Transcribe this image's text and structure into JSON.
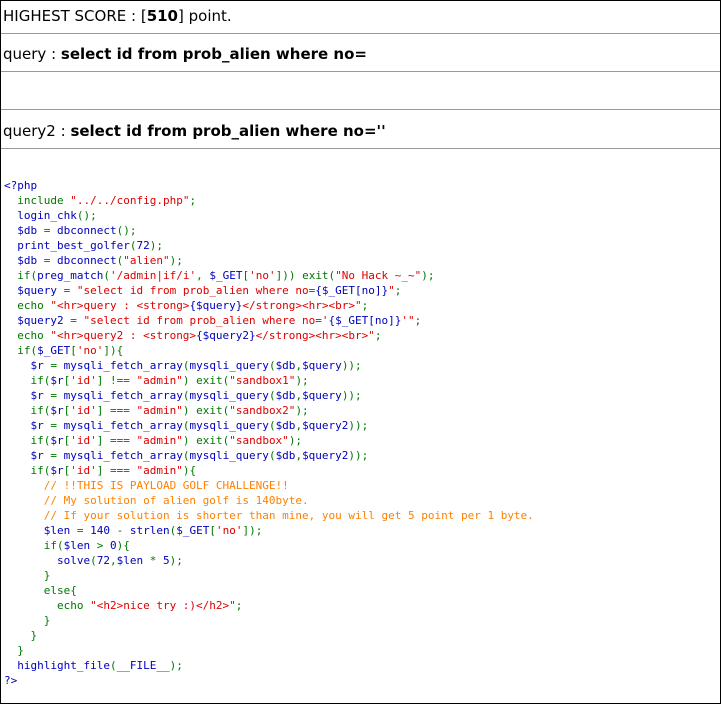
{
  "score": {
    "prefix": "HIGHEST SCORE : [",
    "value": "510",
    "suffix": "] point."
  },
  "query1": {
    "label": "query : ",
    "value": "select id from prob_alien where no="
  },
  "query2": {
    "label": "query2 : ",
    "value": "select id from prob_alien where no=''"
  },
  "source_code": [
    [
      {
        "t": "<?php",
        "c": "d"
      }
    ],
    [
      {
        "t": "  include ",
        "c": "k"
      },
      {
        "t": "\"../../config.php\"",
        "c": "s"
      },
      {
        "t": ";",
        "c": "k"
      }
    ],
    [
      {
        "t": "  login_chk",
        "c": "d"
      },
      {
        "t": "();",
        "c": "k"
      }
    ],
    [
      {
        "t": "  $db ",
        "c": "d"
      },
      {
        "t": "= ",
        "c": "k"
      },
      {
        "t": "dbconnect",
        "c": "d"
      },
      {
        "t": "();",
        "c": "k"
      }
    ],
    [
      {
        "t": "  print_best_golfer",
        "c": "d"
      },
      {
        "t": "(",
        "c": "k"
      },
      {
        "t": "72",
        "c": "d"
      },
      {
        "t": ");",
        "c": "k"
      }
    ],
    [
      {
        "t": "  $db ",
        "c": "d"
      },
      {
        "t": "= ",
        "c": "k"
      },
      {
        "t": "dbconnect",
        "c": "d"
      },
      {
        "t": "(",
        "c": "k"
      },
      {
        "t": "\"alien\"",
        "c": "s"
      },
      {
        "t": ");",
        "c": "k"
      }
    ],
    [
      {
        "t": "  if(",
        "c": "k"
      },
      {
        "t": "preg_match",
        "c": "d"
      },
      {
        "t": "(",
        "c": "k"
      },
      {
        "t": "'/admin|if/i'",
        "c": "s"
      },
      {
        "t": ", ",
        "c": "k"
      },
      {
        "t": "$_GET",
        "c": "d"
      },
      {
        "t": "[",
        "c": "k"
      },
      {
        "t": "'no'",
        "c": "s"
      },
      {
        "t": "])) exit(",
        "c": "k"
      },
      {
        "t": "\"No Hack ~_~\"",
        "c": "s"
      },
      {
        "t": ");",
        "c": "k"
      }
    ],
    [
      {
        "t": "  $query ",
        "c": "d"
      },
      {
        "t": "= ",
        "c": "k"
      },
      {
        "t": "\"select id from prob_alien where no=",
        "c": "s"
      },
      {
        "t": "{$_GET[no]}",
        "c": "d"
      },
      {
        "t": "\"",
        "c": "s"
      },
      {
        "t": ";",
        "c": "k"
      }
    ],
    [
      {
        "t": "  echo ",
        "c": "k"
      },
      {
        "t": "\"<hr>query : <strong>",
        "c": "s"
      },
      {
        "t": "{$query}",
        "c": "d"
      },
      {
        "t": "</strong><hr><br>\"",
        "c": "s"
      },
      {
        "t": ";",
        "c": "k"
      }
    ],
    [
      {
        "t": "  $query2 ",
        "c": "d"
      },
      {
        "t": "= ",
        "c": "k"
      },
      {
        "t": "\"select id from prob_alien where no='",
        "c": "s"
      },
      {
        "t": "{$_GET[no]}",
        "c": "d"
      },
      {
        "t": "'\"",
        "c": "s"
      },
      {
        "t": ";",
        "c": "k"
      }
    ],
    [
      {
        "t": "  echo ",
        "c": "k"
      },
      {
        "t": "\"<hr>query2 : <strong>",
        "c": "s"
      },
      {
        "t": "{$query2}",
        "c": "d"
      },
      {
        "t": "</strong><hr><br>\"",
        "c": "s"
      },
      {
        "t": ";",
        "c": "k"
      }
    ],
    [
      {
        "t": "  if(",
        "c": "k"
      },
      {
        "t": "$_GET",
        "c": "d"
      },
      {
        "t": "[",
        "c": "k"
      },
      {
        "t": "'no'",
        "c": "s"
      },
      {
        "t": "]){",
        "c": "k"
      }
    ],
    [
      {
        "t": "    $r ",
        "c": "d"
      },
      {
        "t": "= ",
        "c": "k"
      },
      {
        "t": "mysqli_fetch_array",
        "c": "d"
      },
      {
        "t": "(",
        "c": "k"
      },
      {
        "t": "mysqli_query",
        "c": "d"
      },
      {
        "t": "(",
        "c": "k"
      },
      {
        "t": "$db",
        "c": "d"
      },
      {
        "t": ",",
        "c": "k"
      },
      {
        "t": "$query",
        "c": "d"
      },
      {
        "t": "));",
        "c": "k"
      }
    ],
    [
      {
        "t": "    if(",
        "c": "k"
      },
      {
        "t": "$r",
        "c": "d"
      },
      {
        "t": "[",
        "c": "k"
      },
      {
        "t": "'id'",
        "c": "s"
      },
      {
        "t": "] !== ",
        "c": "k"
      },
      {
        "t": "\"admin\"",
        "c": "s"
      },
      {
        "t": ") exit(",
        "c": "k"
      },
      {
        "t": "\"sandbox1\"",
        "c": "s"
      },
      {
        "t": ");",
        "c": "k"
      }
    ],
    [
      {
        "t": "    $r ",
        "c": "d"
      },
      {
        "t": "= ",
        "c": "k"
      },
      {
        "t": "mysqli_fetch_array",
        "c": "d"
      },
      {
        "t": "(",
        "c": "k"
      },
      {
        "t": "mysqli_query",
        "c": "d"
      },
      {
        "t": "(",
        "c": "k"
      },
      {
        "t": "$db",
        "c": "d"
      },
      {
        "t": ",",
        "c": "k"
      },
      {
        "t": "$query",
        "c": "d"
      },
      {
        "t": "));",
        "c": "k"
      }
    ],
    [
      {
        "t": "    if(",
        "c": "k"
      },
      {
        "t": "$r",
        "c": "d"
      },
      {
        "t": "[",
        "c": "k"
      },
      {
        "t": "'id'",
        "c": "s"
      },
      {
        "t": "] === ",
        "c": "k"
      },
      {
        "t": "\"admin\"",
        "c": "s"
      },
      {
        "t": ") exit(",
        "c": "k"
      },
      {
        "t": "\"sandbox2\"",
        "c": "s"
      },
      {
        "t": ");",
        "c": "k"
      }
    ],
    [
      {
        "t": "    $r ",
        "c": "d"
      },
      {
        "t": "= ",
        "c": "k"
      },
      {
        "t": "mysqli_fetch_array",
        "c": "d"
      },
      {
        "t": "(",
        "c": "k"
      },
      {
        "t": "mysqli_query",
        "c": "d"
      },
      {
        "t": "(",
        "c": "k"
      },
      {
        "t": "$db",
        "c": "d"
      },
      {
        "t": ",",
        "c": "k"
      },
      {
        "t": "$query2",
        "c": "d"
      },
      {
        "t": "));",
        "c": "k"
      }
    ],
    [
      {
        "t": "    if(",
        "c": "k"
      },
      {
        "t": "$r",
        "c": "d"
      },
      {
        "t": "[",
        "c": "k"
      },
      {
        "t": "'id'",
        "c": "s"
      },
      {
        "t": "] === ",
        "c": "k"
      },
      {
        "t": "\"admin\"",
        "c": "s"
      },
      {
        "t": ") exit(",
        "c": "k"
      },
      {
        "t": "\"sandbox\"",
        "c": "s"
      },
      {
        "t": ");",
        "c": "k"
      }
    ],
    [
      {
        "t": "    $r ",
        "c": "d"
      },
      {
        "t": "= ",
        "c": "k"
      },
      {
        "t": "mysqli_fetch_array",
        "c": "d"
      },
      {
        "t": "(",
        "c": "k"
      },
      {
        "t": "mysqli_query",
        "c": "d"
      },
      {
        "t": "(",
        "c": "k"
      },
      {
        "t": "$db",
        "c": "d"
      },
      {
        "t": ",",
        "c": "k"
      },
      {
        "t": "$query2",
        "c": "d"
      },
      {
        "t": "));",
        "c": "k"
      }
    ],
    [
      {
        "t": "    if(",
        "c": "k"
      },
      {
        "t": "$r",
        "c": "d"
      },
      {
        "t": "[",
        "c": "k"
      },
      {
        "t": "'id'",
        "c": "s"
      },
      {
        "t": "] === ",
        "c": "k"
      },
      {
        "t": "\"admin\"",
        "c": "s"
      },
      {
        "t": "){",
        "c": "k"
      }
    ],
    [
      {
        "t": "      // !!THIS IS PAYLOAD GOLF CHALLENGE!!",
        "c": "c"
      }
    ],
    [
      {
        "t": "      // My solution of alien golf is 140byte.",
        "c": "c"
      }
    ],
    [
      {
        "t": "      // If your solution is shorter than mine, you will get 5 point per 1 byte.",
        "c": "c"
      }
    ],
    [
      {
        "t": "      $len ",
        "c": "d"
      },
      {
        "t": "= ",
        "c": "k"
      },
      {
        "t": "140 ",
        "c": "d"
      },
      {
        "t": "- ",
        "c": "k"
      },
      {
        "t": "strlen",
        "c": "d"
      },
      {
        "t": "(",
        "c": "k"
      },
      {
        "t": "$_GET",
        "c": "d"
      },
      {
        "t": "[",
        "c": "k"
      },
      {
        "t": "'no'",
        "c": "s"
      },
      {
        "t": "]);",
        "c": "k"
      }
    ],
    [
      {
        "t": "      if(",
        "c": "k"
      },
      {
        "t": "$len ",
        "c": "d"
      },
      {
        "t": "> ",
        "c": "k"
      },
      {
        "t": "0",
        "c": "d"
      },
      {
        "t": "){",
        "c": "k"
      }
    ],
    [
      {
        "t": "        solve",
        "c": "d"
      },
      {
        "t": "(",
        "c": "k"
      },
      {
        "t": "72",
        "c": "d"
      },
      {
        "t": ",",
        "c": "k"
      },
      {
        "t": "$len ",
        "c": "d"
      },
      {
        "t": "* ",
        "c": "k"
      },
      {
        "t": "5",
        "c": "d"
      },
      {
        "t": ");",
        "c": "k"
      }
    ],
    [
      {
        "t": "      }",
        "c": "k"
      }
    ],
    [
      {
        "t": "      else{",
        "c": "k"
      }
    ],
    [
      {
        "t": "        echo ",
        "c": "k"
      },
      {
        "t": "\"<h2>nice try :)</h2>\"",
        "c": "s"
      },
      {
        "t": ";",
        "c": "k"
      }
    ],
    [
      {
        "t": "      }",
        "c": "k"
      }
    ],
    [
      {
        "t": "    }",
        "c": "k"
      }
    ],
    [
      {
        "t": "  }",
        "c": "k"
      }
    ],
    [
      {
        "t": "  highlight_file",
        "c": "d"
      },
      {
        "t": "(",
        "c": "k"
      },
      {
        "t": "__FILE__",
        "c": "d"
      },
      {
        "t": ");",
        "c": "k"
      }
    ],
    [
      {
        "t": "?>",
        "c": "d"
      }
    ]
  ],
  "colors": {
    "default": "#0000bb",
    "keyword": "#007700",
    "string": "#dd0000",
    "comment": "#ff8000"
  }
}
